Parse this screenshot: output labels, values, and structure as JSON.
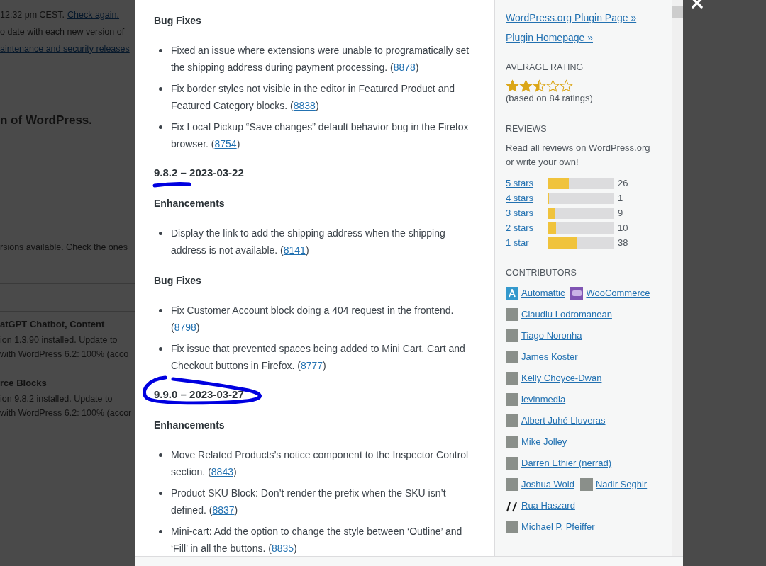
{
  "background": {
    "lines": [
      {
        "kind": "text",
        "text": "12:32 pm CEST.",
        "link": "Check again."
      },
      {
        "kind": "text",
        "text": "o date with each new version of"
      },
      {
        "kind": "link",
        "text": "aintenance and security releases"
      },
      {
        "kind": "heading",
        "text": "n of WordPress."
      },
      {
        "kind": "text",
        "text": "rsions available. Check the ones"
      },
      {
        "kind": "rule"
      },
      {
        "kind": "rule"
      },
      {
        "kind": "plugin",
        "title": "atGPT Chatbot, Content",
        "version": "ion 1.3.90 installed. Update to",
        "compat": "with WordPress 6.2: 100% (acco"
      },
      {
        "kind": "plugin",
        "title": "rce Blocks",
        "version": "ion 9.8.2 installed. Update to",
        "compat": "with WordPress 6.2: 100% (accor"
      },
      {
        "kind": "rule"
      }
    ]
  },
  "changelog": [
    {
      "kind": "subheading",
      "text": "Bug Fixes"
    },
    {
      "kind": "list",
      "items": [
        {
          "text": "Fixed an issue where extensions were unable to programatically set the shipping address during payment processing. (",
          "link": "8878",
          "tail": ")"
        },
        {
          "text": "Fix border styles not visible in the editor in Featured Product and Featured Category blocks. (",
          "link": "8838",
          "tail": ")"
        },
        {
          "text": "Fix Local Pickup “Save changes” default behavior bug in the Firefox browser. (",
          "link": "8754",
          "tail": ")"
        }
      ]
    },
    {
      "kind": "version",
      "text": "9.8.2 – 2023-03-22",
      "underlined": true,
      "circled": false
    },
    {
      "kind": "subheading",
      "text": "Enhancements"
    },
    {
      "kind": "list",
      "items": [
        {
          "text": "Display the link to add the shipping address when the shipping address is not available. (",
          "link": "8141",
          "tail": ")"
        }
      ]
    },
    {
      "kind": "subheading",
      "text": "Bug Fixes"
    },
    {
      "kind": "list",
      "items": [
        {
          "text": "Fix Customer Account block doing a 404 request in the frontend. (",
          "link": "8798",
          "tail": ")"
        },
        {
          "text": "Fix issue that prevented spaces being added to Mini Cart, Cart and Checkout buttons in Firefox. (",
          "link": "8777",
          "tail": ")"
        }
      ]
    },
    {
      "kind": "version",
      "text": "9.9.0 – 2023-03-27",
      "underlined": false,
      "circled": true
    },
    {
      "kind": "subheading",
      "text": "Enhancements"
    },
    {
      "kind": "list",
      "items": [
        {
          "text": "Move Related Products’s notice component to the Inspector Control section. (",
          "link": "8843",
          "tail": ")"
        },
        {
          "text": "Product SKU Block: Don’t render the prefix when the SKU isn’t defined. (",
          "link": "8837",
          "tail": ")"
        },
        {
          "text": "Mini-cart: Add the option to change the style between ‘Outline’ and ‘Fill’ in all the buttons. (",
          "link": "8835",
          "tail": ")"
        }
      ]
    }
  ],
  "sidebar": {
    "links": [
      "WordPress.org Plugin Page »",
      "Plugin Homepage »"
    ],
    "rating": {
      "heading": "AVERAGE RATING",
      "stars": 2.5,
      "note": "(based on 84 ratings)"
    },
    "reviews": {
      "heading": "REVIEWS",
      "text": "Read all reviews on WordPress.org or write your own!",
      "bars": [
        {
          "label": "5 stars",
          "level": 0.31,
          "count": "26"
        },
        {
          "label": "4 stars",
          "level": 0.01,
          "count": "1"
        },
        {
          "label": "3 stars",
          "level": 0.11,
          "count": "9"
        },
        {
          "label": "2 stars",
          "level": 0.12,
          "count": "10"
        },
        {
          "label": "1 star",
          "level": 0.45,
          "count": "38"
        }
      ]
    },
    "contributors": {
      "heading": "CONTRIBUTORS",
      "rows": [
        [
          {
            "name": "Automattic",
            "kind": "a-logo"
          },
          {
            "name": "WooCommerce",
            "kind": "woo-logo"
          }
        ],
        [
          {
            "name": "Claudiu Lodromanean",
            "kind": "photo"
          }
        ],
        [
          {
            "name": "Tiago Noronha",
            "kind": "photo"
          }
        ],
        [
          {
            "name": "James Koster",
            "kind": "photo"
          }
        ],
        [
          {
            "name": "Kelly Choyce-Dwan",
            "kind": "photo"
          }
        ],
        [
          {
            "name": "levinmedia",
            "kind": "photo"
          }
        ],
        [
          {
            "name": "Albert Juhé Lluveras",
            "kind": "photo"
          }
        ],
        [
          {
            "name": "Mike Jolley",
            "kind": "photo"
          }
        ],
        [
          {
            "name": "Darren Ethier (nerrad)",
            "kind": "photo"
          }
        ],
        [
          {
            "name": "Joshua Wold",
            "kind": "photo"
          },
          {
            "name": "Nadir Seghir",
            "kind": "photo"
          }
        ],
        [
          {
            "name": "Rua Haszard",
            "kind": "sketch"
          }
        ],
        [
          {
            "name": "Michael P. Pfeiffer",
            "kind": "photo"
          }
        ]
      ]
    }
  }
}
